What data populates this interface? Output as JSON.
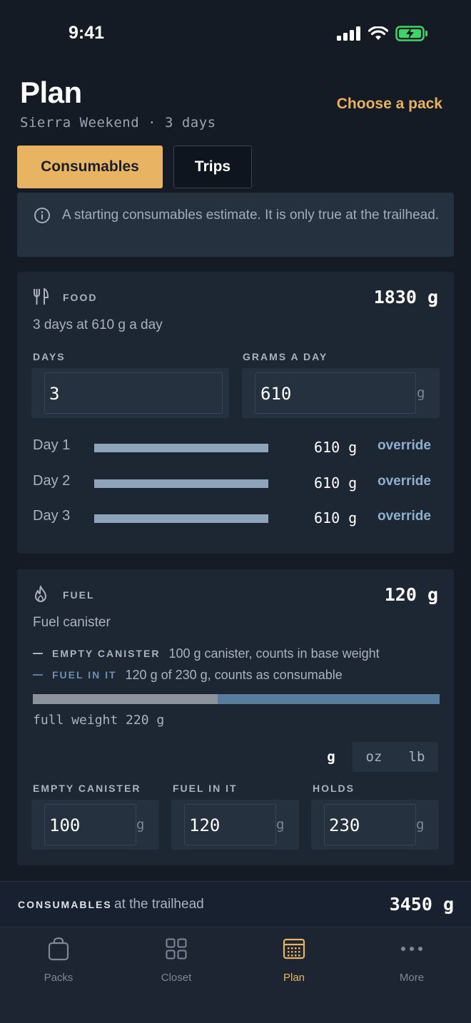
{
  "status": {
    "time": "9:41"
  },
  "header": {
    "title": "Plan",
    "subtitle": "Sierra Weekend · 3 days",
    "choose_pack": "Choose a pack"
  },
  "tabs": [
    {
      "label": "Consumables",
      "active": true
    },
    {
      "label": "Trips",
      "active": false
    }
  ],
  "info": {
    "text": "A starting consumables estimate. It is only true at the trailhead."
  },
  "food": {
    "label": "FOOD",
    "total": "1830 g",
    "description": "3 days at 610 g a day",
    "days_label": "DAYS",
    "days_value": "3",
    "grams_label": "GRAMS A DAY",
    "grams_value": "610",
    "grams_unit": "g",
    "rows": [
      {
        "label": "Day 1",
        "value": "610 g",
        "action": "override",
        "fill": 1.0
      },
      {
        "label": "Day 2",
        "value": "610 g",
        "action": "override",
        "fill": 1.0
      },
      {
        "label": "Day 3",
        "value": "610 g",
        "action": "override",
        "fill": 1.0
      }
    ]
  },
  "fuel": {
    "label": "FUEL",
    "total": "120 g",
    "description": "Fuel canister",
    "legend": [
      {
        "key": "EMPTY CANISTER",
        "text": "100 g canister, counts in base weight"
      },
      {
        "key": "FUEL IN IT",
        "text": "120 g of 230 g, counts as consumable"
      }
    ],
    "bar": {
      "empty_g": 100,
      "fuel_g": 120
    },
    "full_weight": "full weight 220 g",
    "units": [
      "g",
      "oz",
      "lb"
    ],
    "active_unit": "g",
    "fields": [
      {
        "label": "EMPTY CANISTER",
        "value": "100",
        "unit": "g"
      },
      {
        "label": "FUEL IN IT",
        "value": "120",
        "unit": "g"
      },
      {
        "label": "HOLDS",
        "value": "230",
        "unit": "g"
      }
    ]
  },
  "summary": {
    "key": "CONSUMABLES",
    "text": "at the trailhead",
    "total": "3450 g"
  },
  "tabbar": [
    {
      "label": "Packs",
      "icon": "bag-icon"
    },
    {
      "label": "Closet",
      "icon": "grid-icon"
    },
    {
      "label": "Plan",
      "icon": "calendar-icon",
      "active": true
    },
    {
      "label": "More",
      "icon": "more-icon"
    }
  ],
  "colors": {
    "background": "#141b25",
    "card": "#1d2633",
    "accent": "#e8b463",
    "bar_food": "#8da4bb",
    "bar_empty": "#8c929a",
    "bar_fuel": "#587d9f",
    "battery": "#3ed46a"
  }
}
